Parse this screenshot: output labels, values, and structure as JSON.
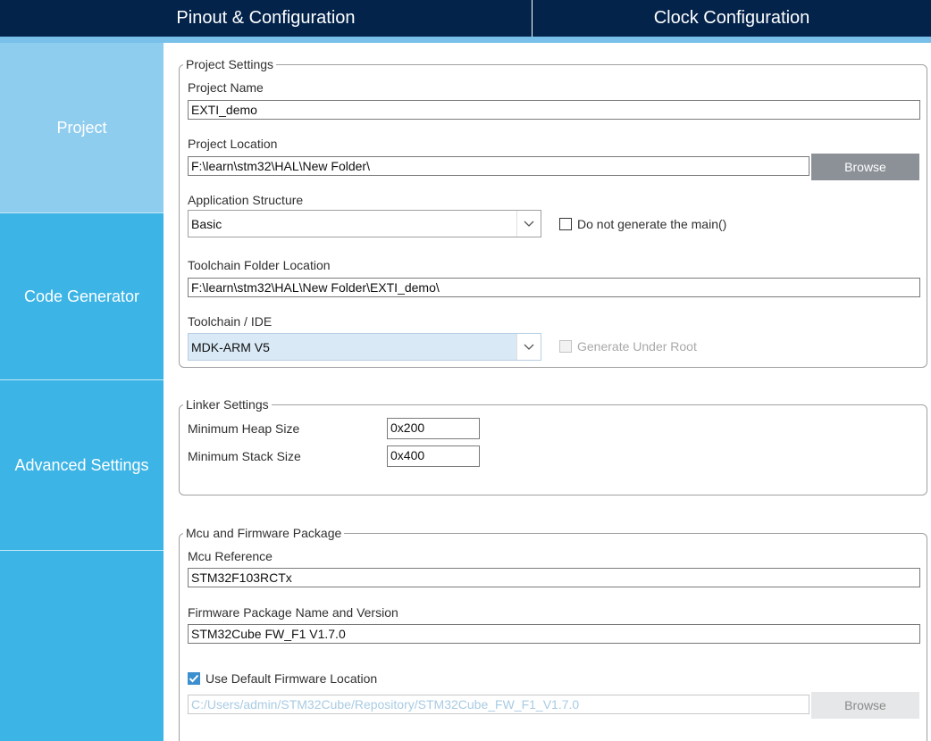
{
  "tabs": {
    "pinout": "Pinout & Configuration",
    "clock": "Clock Configuration"
  },
  "sidebar": {
    "items": [
      {
        "label": "Project"
      },
      {
        "label": "Code Generator"
      },
      {
        "label": "Advanced Settings"
      }
    ]
  },
  "project_settings": {
    "title": "Project Settings",
    "name_label": "Project Name",
    "name_value": "EXTI_demo",
    "location_label": "Project Location",
    "location_value": "F:\\learn\\stm32\\HAL\\New Folder\\",
    "browse": "Browse",
    "structure_label": "Application Structure",
    "structure_value": "Basic",
    "no_main_label": "Do not generate the main()",
    "toolchain_folder_label": "Toolchain Folder Location",
    "toolchain_folder_value": "F:\\learn\\stm32\\HAL\\New Folder\\EXTI_demo\\",
    "toolchain_label": "Toolchain / IDE",
    "toolchain_value": "MDK-ARM V5",
    "gen_root_label": "Generate Under Root"
  },
  "linker_settings": {
    "title": "Linker Settings",
    "heap_label": "Minimum Heap Size",
    "heap_value": "0x200",
    "stack_label": "Minimum Stack Size",
    "stack_value": "0x400"
  },
  "mcu_firmware": {
    "title": "Mcu and Firmware Package",
    "mcu_label": "Mcu Reference",
    "mcu_value": "STM32F103RCTx",
    "fw_label": "Firmware Package Name and Version",
    "fw_value": "STM32Cube FW_F1 V1.7.0",
    "default_loc_label": "Use Default Firmware Location",
    "fw_path_value": "C:/Users/admin/STM32Cube/Repository/STM32Cube_FW_F1_V1.7.0",
    "browse": "Browse"
  },
  "colors": {
    "topbar": "#03234b",
    "sidebar": "#3cb4e6",
    "sidebar_active": "#8fcdef",
    "accent": "#78c0ea"
  }
}
